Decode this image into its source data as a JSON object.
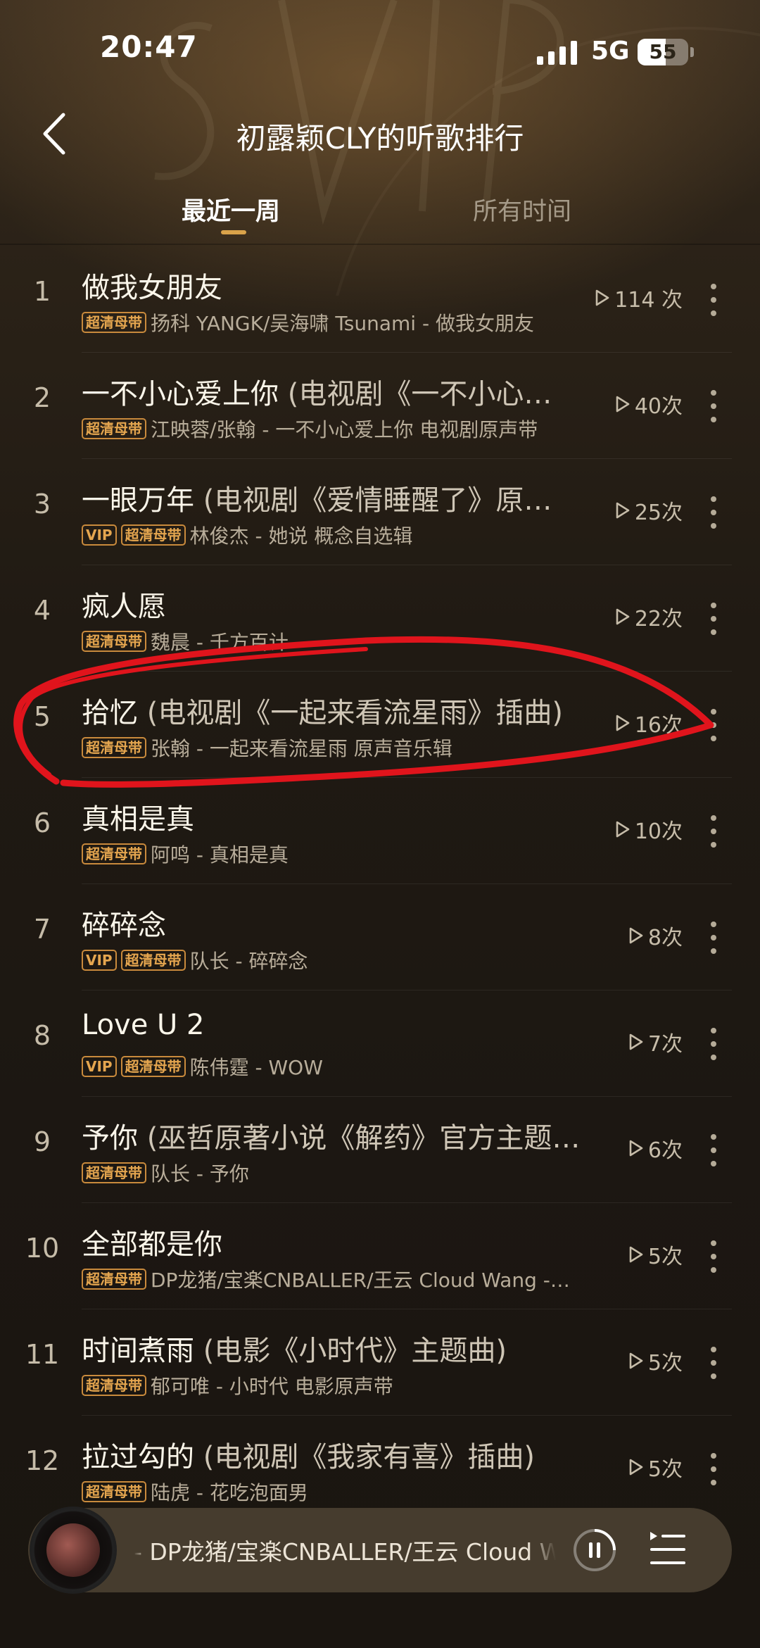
{
  "status_bar": {
    "time": "20:47",
    "network": "5G",
    "battery": "55",
    "battery_level": 0.55
  },
  "header": {
    "title": "初露颖CLY的听歌排行"
  },
  "tabs": [
    {
      "label": "最近一周",
      "active": true
    },
    {
      "label": "所有时间",
      "active": false
    }
  ],
  "songs": [
    {
      "rank": "1",
      "title": "做我女朋友",
      "suffix": "",
      "badges": [
        "超清母带"
      ],
      "artist": "扬科 YANGK/吴海啸 Tsunami - 做我女朋友",
      "plays": "114 次"
    },
    {
      "rank": "2",
      "title": "一不小心爱上你",
      "suffix": " (电视剧《一不小心…",
      "badges": [
        "超清母带"
      ],
      "artist": "江映蓉/张翰 - 一不小心爱上你 电视剧原声带",
      "plays": "40次"
    },
    {
      "rank": "3",
      "title": "一眼万年",
      "suffix": " (电视剧《爱情睡醒了》原…",
      "badges": [
        "VIP",
        "超清母带"
      ],
      "artist": "林俊杰 - 她说 概念自选辑",
      "plays": "25次"
    },
    {
      "rank": "4",
      "title": "疯人愿",
      "suffix": "",
      "badges": [
        "超清母带"
      ],
      "artist": "魏晨 - 千方百计",
      "plays": "22次"
    },
    {
      "rank": "5",
      "title": "拾忆",
      "suffix": " (电视剧《一起来看流星雨》插曲)",
      "badges": [
        "超清母带"
      ],
      "artist": "张翰 - 一起来看流星雨 原声音乐辑",
      "plays": "16次"
    },
    {
      "rank": "6",
      "title": "真相是真",
      "suffix": "",
      "badges": [
        "超清母带"
      ],
      "artist": "阿鸣 - 真相是真",
      "plays": "10次"
    },
    {
      "rank": "7",
      "title": "碎碎念",
      "suffix": "",
      "badges": [
        "VIP",
        "超清母带"
      ],
      "artist": "队长 - 碎碎念",
      "plays": "8次"
    },
    {
      "rank": "8",
      "title": "Love U 2",
      "suffix": "",
      "badges": [
        "VIP",
        "超清母带"
      ],
      "artist": "陈伟霆 - WOW",
      "plays": "7次"
    },
    {
      "rank": "9",
      "title": "予你",
      "suffix": " (巫哲原著小说《解药》官方主题…",
      "badges": [
        "超清母带"
      ],
      "artist": "队长 - 予你",
      "plays": "6次"
    },
    {
      "rank": "10",
      "title": "全部都是你",
      "suffix": "",
      "badges": [
        "超清母带"
      ],
      "artist": "DP龙猪/宝楽CNBALLER/王云 Cloud Wang -…",
      "plays": "5次"
    },
    {
      "rank": "11",
      "title": "时间煮雨",
      "suffix": " (电影《小时代》主题曲)",
      "badges": [
        "超清母带"
      ],
      "artist": "郁可唯 - 小时代 电影原声带",
      "plays": "5次"
    },
    {
      "rank": "12",
      "title": "拉过勾的",
      "suffix": " (电视剧《我家有喜》插曲)",
      "badges": [
        "超清母带"
      ],
      "artist": "陆虎 - 花吃泡面男",
      "plays": "5次"
    }
  ],
  "player": {
    "now_playing": "- DP龙猪/宝楽CNBALLER/王云 Cloud Wang"
  },
  "colors": {
    "accent": "#d9a24a",
    "badge": "#e5a64f",
    "annotation": "#e0141c"
  }
}
